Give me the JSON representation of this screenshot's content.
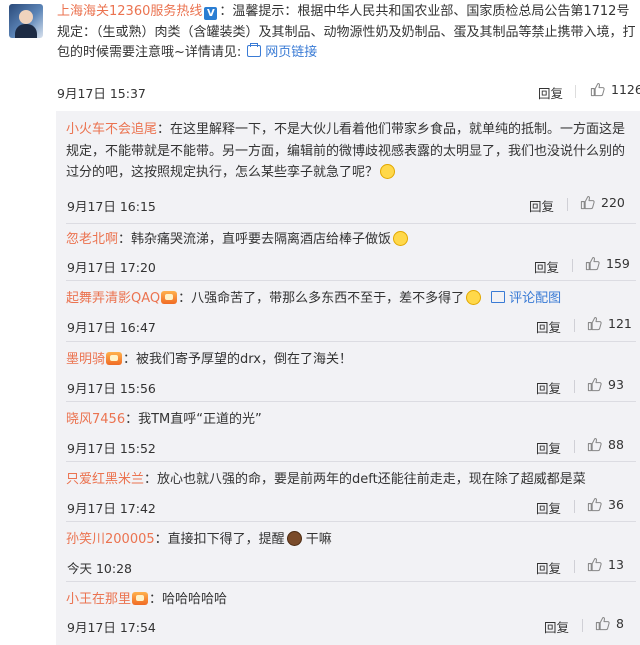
{
  "post": {
    "username": "上海海关12360服务热线",
    "text": "：温馨提示：根据中华人民共和国农业部、国家质检总局公告第1712号规定：（生或熟）肉类（含罐装类）及其制品、动物源性奶及奶制品、蛋及其制品等禁止携带入境，打包的时候需要注意哦~详情请见:",
    "link_label": "网页链接",
    "time": "9月17日 15:37",
    "reply_label": "回复",
    "likes": "1126",
    "icons": {
      "verified": "verified-v-badge",
      "link": "link-icon",
      "like": "thumbs-up-icon"
    },
    "colors": {
      "username": "#eb7350",
      "link": "#3a7bd5",
      "verified": "#2a7ed3"
    }
  },
  "comments": [
    {
      "user": "小火车不会追尾",
      "text": "：在这里解释一下，不是大伙儿看着他们带家乡食品，就单纯的抵制。一方面这是规定，不能带就是不能带。另一方面，编辑前的微博歧视感表露的太明显了，我们也没说什么别的过分的吧，这按照规定执行，怎么某些孪子就急了呢？",
      "time": "9月17日 16:15",
      "reply_label": "回复",
      "likes": "220"
    },
    {
      "user": "忽老北啊",
      "text": "：韩杂痛哭流涕，直呼要去隔离酒店给棒子做饭",
      "time": "9月17日 17:20",
      "reply_label": "回复",
      "likes": "159"
    },
    {
      "user": "起舞弄清影QAQ",
      "text": "：八强命苦了，带那么多东西不至于，差不多得了",
      "extra_label": "评论配图",
      "time": "9月17日 16:47",
      "reply_label": "回复",
      "likes": "121"
    },
    {
      "user": "墨明骑",
      "text": "：被我们寄予厚望的drx，倒在了海关！",
      "time": "9月17日 15:56",
      "reply_label": "回复",
      "likes": "93"
    },
    {
      "user": "晓风7456",
      "text": "：我TM直呼“正道的光”",
      "time": "9月17日 15:52",
      "reply_label": "回复",
      "likes": "88"
    },
    {
      "user": "只爱红黑米兰",
      "text": "：放心也就八强的命，要是前两年的deft还能往前走走，现在除了超威都是菜",
      "time": "9月17日 17:42",
      "reply_label": "回复",
      "likes": "36"
    },
    {
      "user": "孙笑川200005",
      "text": "：直接扣下得了，提醒",
      "text_after_emoji": "干嘛",
      "time": "今天 10:28",
      "reply_label": "回复",
      "likes": "13"
    },
    {
      "user": "小王在那里",
      "text": "：哈哈哈哈哈",
      "time": "9月17日 17:54",
      "reply_label": "回复",
      "likes": "8"
    }
  ]
}
